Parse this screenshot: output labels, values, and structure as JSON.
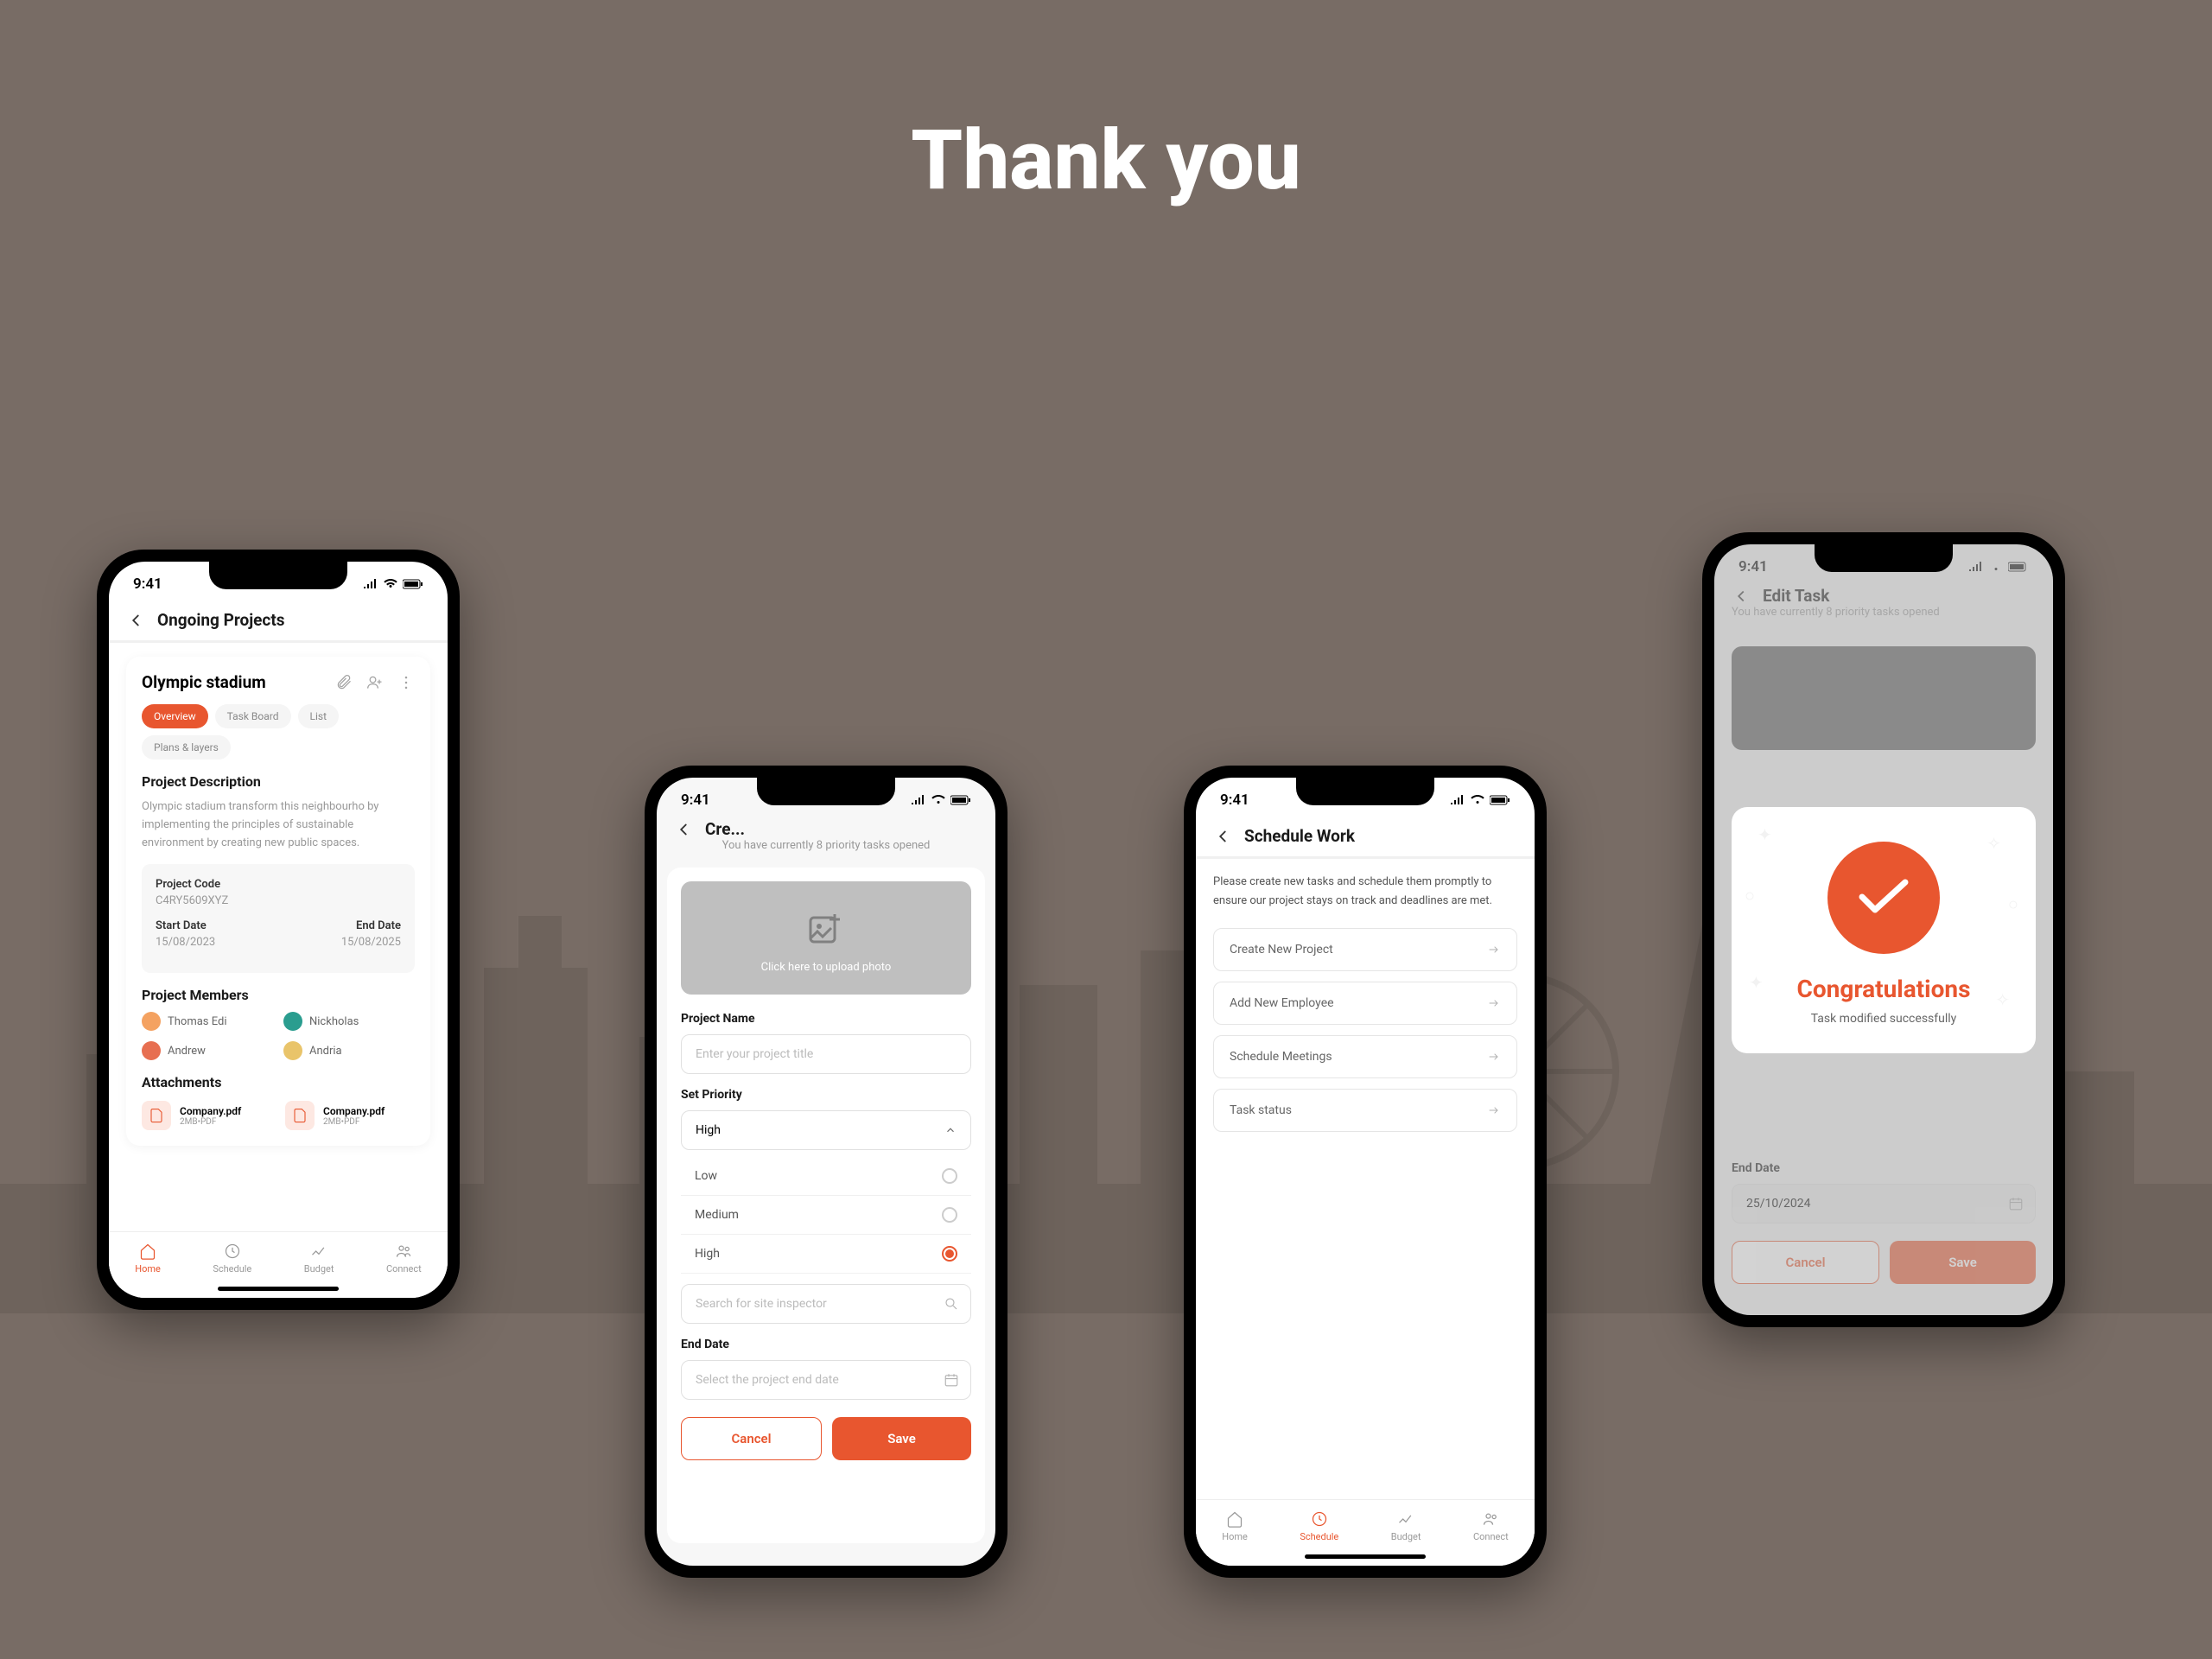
{
  "title": "Thank you",
  "status_time": "9:41",
  "phone1": {
    "header": "Ongoing Projects",
    "project_title": "Olympic stadium",
    "tabs": [
      "Overview",
      "Task Board",
      "List",
      "Plans & layers"
    ],
    "desc_title": "Project Description",
    "desc_text": "Olympic stadium transform this neighbourho by implementing the principles of sustainable environment by creating new public spaces.",
    "code_label": "Project Code",
    "code_value": "C4RY5609XYZ",
    "start_label": "Start Date",
    "start_value": "15/08/2023",
    "end_label": "End Date",
    "end_value": "15/08/2025",
    "members_title": "Project Members",
    "members": [
      "Thomas Edi",
      "Nickholas",
      "Andrew",
      "Andria"
    ],
    "attachments_title": "Attachments",
    "att_name": "Company.pdf",
    "att_meta": "2MB•PDF"
  },
  "phone2": {
    "header": "Cre...",
    "subtitle": "You have currently 8 priority tasks opened",
    "upload_text": "Click here to upload photo",
    "name_label": "Project Name",
    "name_placeholder": "Enter your project title",
    "priority_label": "Set Priority",
    "priority_selected": "High",
    "priority_options": [
      "Low",
      "Medium",
      "High"
    ],
    "search_placeholder": "Search for site inspector",
    "enddate_label": "End Date",
    "enddate_placeholder": "Select the project end date",
    "cancel": "Cancel",
    "save": "Save"
  },
  "phone3": {
    "header": "Schedule Work",
    "instruction": "Please create new tasks and schedule them promptly to ensure our project stays on track and deadlines are met.",
    "actions": [
      "Create New Project",
      "Add New Employee",
      "Schedule Meetings",
      "Task status"
    ]
  },
  "phone4": {
    "header": "Edit Task",
    "subtitle": "You have currently 8 priority tasks opened",
    "congrats": "Congratulations",
    "success_msg": "Task modified successfully",
    "enddate_label": "End Date",
    "enddate_value": "25/10/2024",
    "cancel": "Cancel",
    "save": "Save"
  },
  "nav": {
    "home": "Home",
    "schedule": "Schedule",
    "budget": "Budget",
    "connect": "Connect"
  }
}
